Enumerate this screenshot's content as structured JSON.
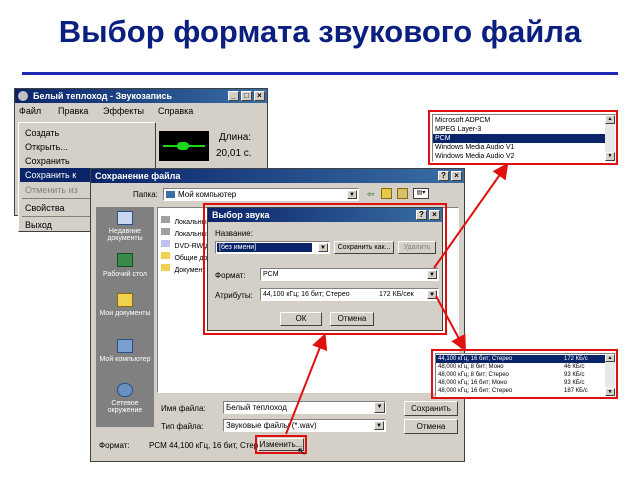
{
  "slide": {
    "title": "Выбор формата звукового файла"
  },
  "recorder": {
    "title": "Белый теплоход - Звукозапись",
    "menu": [
      "Файл",
      "Правка",
      "Эффекты",
      "Справка"
    ],
    "length_label": "Длина:",
    "length_value": "20,01 с."
  },
  "file_menu": {
    "items": [
      "Создать",
      "Открыть...",
      "Сохранить",
      "Сохранить к",
      "Отменить из",
      "Свойства",
      "Выход"
    ]
  },
  "save_dialog": {
    "title": "Сохранение файла",
    "folder_label": "Папка:",
    "folder_value": "Мой компьютер",
    "places": [
      "Недавние документы",
      "Рабочий стол",
      "Мои документы",
      "Мой компьютер",
      "Сетевое окружение"
    ],
    "files": [
      "Локальный",
      "Локальный",
      "DVD-RW д",
      "Общие до",
      "Документ"
    ],
    "filename_label": "Имя файла:",
    "filename_value": "Белый теплоход",
    "filetype_label": "Тип файла:",
    "filetype_value": "Звуковые файлы (*.wav)",
    "save_button": "Сохранить",
    "cancel_button": "Отмена",
    "format_label": "Формат:",
    "format_value": "PCM 44,100 кГц, 16 бит, Стер",
    "change_button": "Изменить..."
  },
  "sound_dialog": {
    "title": "Выбор звука",
    "name_label": "Название:",
    "name_value": "[без имени]",
    "save_as_button": "Сохранить как...",
    "delete_button": "Удалить",
    "format_label": "Формат:",
    "format_value": "PCM",
    "attributes_label": "Атрибуты:",
    "attributes_value": "44,100 кГц; 16 бит; Стерео",
    "attributes_size": "172 КБ/сек",
    "ok_button": "ОК",
    "cancel_button": "Отмена"
  },
  "format_list": {
    "items": [
      "Microsoft ADPCM",
      "MPEG Layer-3",
      "PCM",
      "Windows Media Audio V1",
      "Windows Media Audio V2"
    ],
    "selected_index": 2
  },
  "attributes_list": {
    "rows": [
      {
        "attr": "44,100 кГц; 16 бит; Стерео",
        "rate": "172 КБ/с"
      },
      {
        "attr": "48,000 кГц; 8 бит; Моно",
        "rate": "46 КБ/с"
      },
      {
        "attr": "48,000 кГц; 8 бит; Стерео",
        "rate": "93 КБ/с"
      },
      {
        "attr": "48,000 кГц; 16 бит; Моно",
        "rate": "93 КБ/с"
      },
      {
        "attr": "48,000 кГц; 16 бит; Стерео",
        "rate": "187 КБ/с"
      }
    ],
    "selected_index": 0
  },
  "colors": {
    "accent_red": "#e01010",
    "title_blue": "#0b1f80",
    "selection": "#0a246a"
  }
}
